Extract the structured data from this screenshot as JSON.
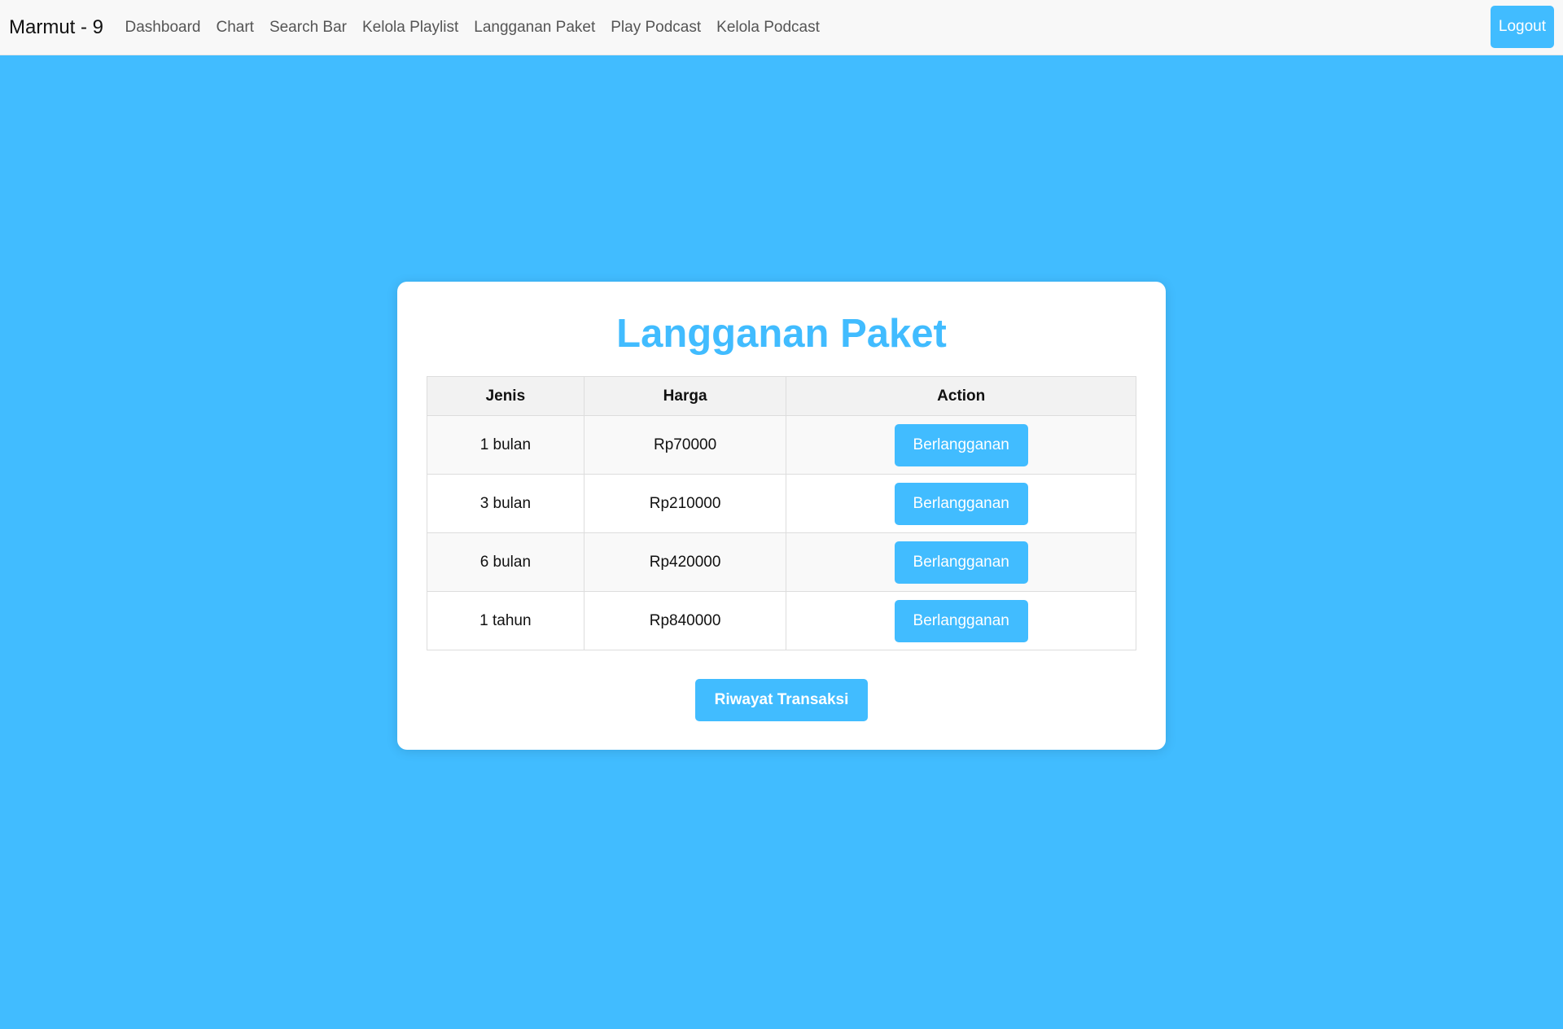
{
  "navbar": {
    "brand": "Marmut - 9",
    "links": [
      "Dashboard",
      "Chart",
      "Search Bar",
      "Kelola Playlist",
      "Langganan Paket",
      "Play Podcast",
      "Kelola Podcast"
    ],
    "logout_label": "Logout"
  },
  "main": {
    "title": "Langganan Paket",
    "table": {
      "headers": [
        "Jenis",
        "Harga",
        "Action"
      ],
      "rows": [
        {
          "jenis": "1 bulan",
          "harga": "Rp70000",
          "action_label": "Berlangganan"
        },
        {
          "jenis": "3 bulan",
          "harga": "Rp210000",
          "action_label": "Berlangganan"
        },
        {
          "jenis": "6 bulan",
          "harga": "Rp420000",
          "action_label": "Berlangganan"
        },
        {
          "jenis": "1 tahun",
          "harga": "Rp840000",
          "action_label": "Berlangganan"
        }
      ]
    },
    "history_label": "Riwayat Transaksi"
  },
  "colors": {
    "accent": "#41bcff",
    "navbar_bg": "#f8f8f8"
  }
}
